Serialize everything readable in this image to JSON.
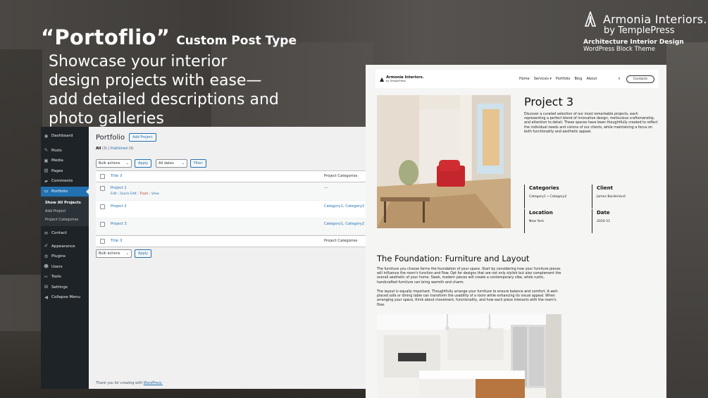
{
  "hero": {
    "headline_main": "“Portoflio”",
    "headline_sub": "Custom Post Type",
    "tagline": "Showcase your interior design projects with ease—add detailed descriptions and photo galleries"
  },
  "brand": {
    "name": "Armonia Interiors.",
    "by": "by TemplePress",
    "line1": "Architecture Interior Design",
    "line2": "WordPress Block Theme"
  },
  "wp_admin": {
    "sidebar": [
      {
        "icon": "dashboard-icon",
        "glyph": "◉",
        "label": "Dashboard"
      },
      {
        "icon": "pin-icon",
        "glyph": "✎",
        "label": "Posts"
      },
      {
        "icon": "media-icon",
        "glyph": "▣",
        "label": "Media"
      },
      {
        "icon": "pages-icon",
        "glyph": "▤",
        "label": "Pages"
      },
      {
        "icon": "comments-icon",
        "glyph": "▰",
        "label": "Comments"
      },
      {
        "icon": "portfolio-icon",
        "glyph": "▭",
        "label": "Portfolio"
      }
    ],
    "submenu": [
      "Show All Projects",
      "Add Project",
      "Project Categories"
    ],
    "sidebar_bottom": [
      {
        "icon": "mail-icon",
        "glyph": "✉",
        "label": "Contact"
      },
      {
        "icon": "appearance-icon",
        "glyph": "✐",
        "label": "Appearance"
      },
      {
        "icon": "plugins-icon",
        "glyph": "⚙",
        "label": "Plugins"
      },
      {
        "icon": "users-icon",
        "glyph": "☻",
        "label": "Users"
      },
      {
        "icon": "tools-icon",
        "glyph": "✂",
        "label": "Tools"
      },
      {
        "icon": "settings-icon",
        "glyph": "⊞",
        "label": "Settings"
      },
      {
        "icon": "collapse-icon",
        "glyph": "◀",
        "label": "Collapse Menu"
      }
    ],
    "page_title": "Portfolio",
    "add_button": "Add Project",
    "filter_all": "All",
    "filter_all_count": "(3)",
    "filter_sep": "|",
    "filter_published": "Published",
    "filter_published_count": "(3)",
    "bulk_actions": "Bulk actions",
    "apply": "Apply",
    "all_dates": "All dates",
    "filter_btn": "Filter",
    "col_title": "Title",
    "col_sort": "⇕",
    "col_categories": "Project Categories",
    "rows": [
      {
        "title": "Project 1",
        "categories": "—",
        "actions": {
          "edit": "Edit",
          "quick": "Quick Edit",
          "trash": "Trash",
          "view": "View"
        }
      },
      {
        "title": "Project 2",
        "categories": "Category1, Category2"
      },
      {
        "title": "Project 3",
        "categories": "Category1, Category2"
      }
    ],
    "footer_text": "Thank you for creating with",
    "footer_link": "WordPress."
  },
  "site": {
    "logo_name": "Armonia Interiors.",
    "logo_by": "by TemplePress",
    "menu": [
      "Home",
      "Services ▾",
      "Portfolio",
      "Blog",
      "About"
    ],
    "contact": "Contacts",
    "project_title": "Project 3",
    "project_desc": "Discover a curated selection of our most remarkable projects, each representing a perfect blend of innovative design, meticulous craftsmanship, and attention to detail. These spaces have been thoughtfully created to reflect the individual needs and visions of our clients, while maintaining a focus on both functionality and aesthetic appeal.",
    "meta": {
      "categories_label": "Categories",
      "categories_value": "Category1 • Category2",
      "client_label": "Client",
      "client_value": "James Borderland",
      "location_label": "Location",
      "location_value": "New York",
      "date_label": "Date",
      "date_value": "2024-11"
    },
    "section_heading": "The Foundation: Furniture and Layout",
    "para1": "The furniture you choose forms the foundation of your space. Start by considering how your furniture pieces will influence the room's function and flow. Opt for designs that are not only stylish but also complement the overall aesthetic of your home. Sleek, modern pieces will create a contemporary vibe, while rustic, handcrafted furniture can bring warmth and charm.",
    "para2": "The layout is equally important. Thoughtfully arrange your furniture to ensure balance and comfort. A well-placed sofa or dining table can transform the usability of a room while enhancing its visual appeal. When arranging your space, think about movement, functionality, and how each piece interacts with the room's flow."
  }
}
